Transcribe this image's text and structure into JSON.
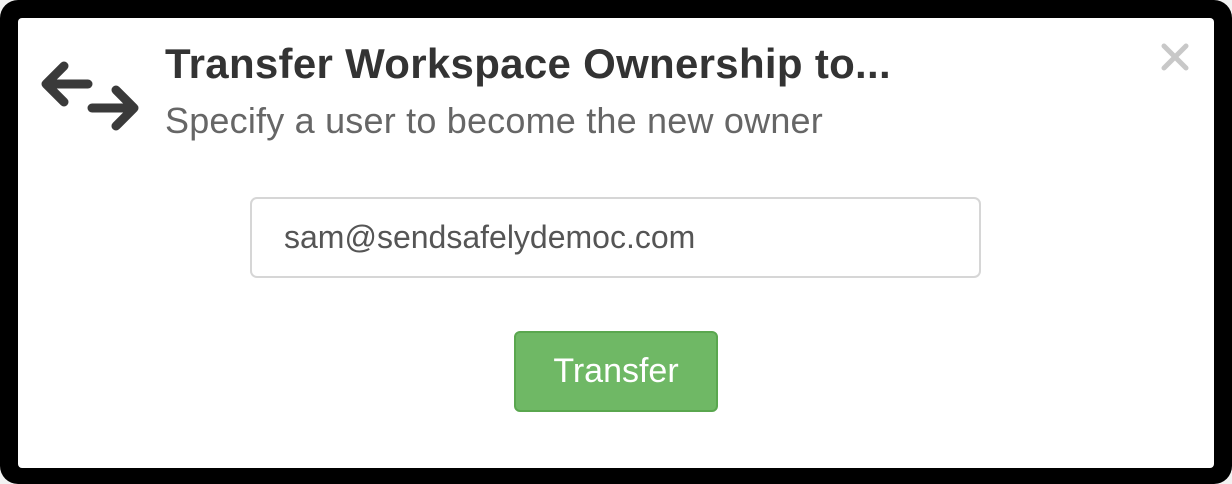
{
  "modal": {
    "title": "Transfer Workspace Ownership to...",
    "subtitle": "Specify a user to become the new owner",
    "close_glyph": "×",
    "header_icon": "arrows-left-right-icon"
  },
  "form": {
    "email_value": "sam@sendsafelydemoc.com"
  },
  "actions": {
    "transfer_label": "Transfer"
  },
  "colors": {
    "primary_button": "#6fb865",
    "title_text": "#333333",
    "subtitle_text": "#666666",
    "overlay_border": "#000000"
  }
}
